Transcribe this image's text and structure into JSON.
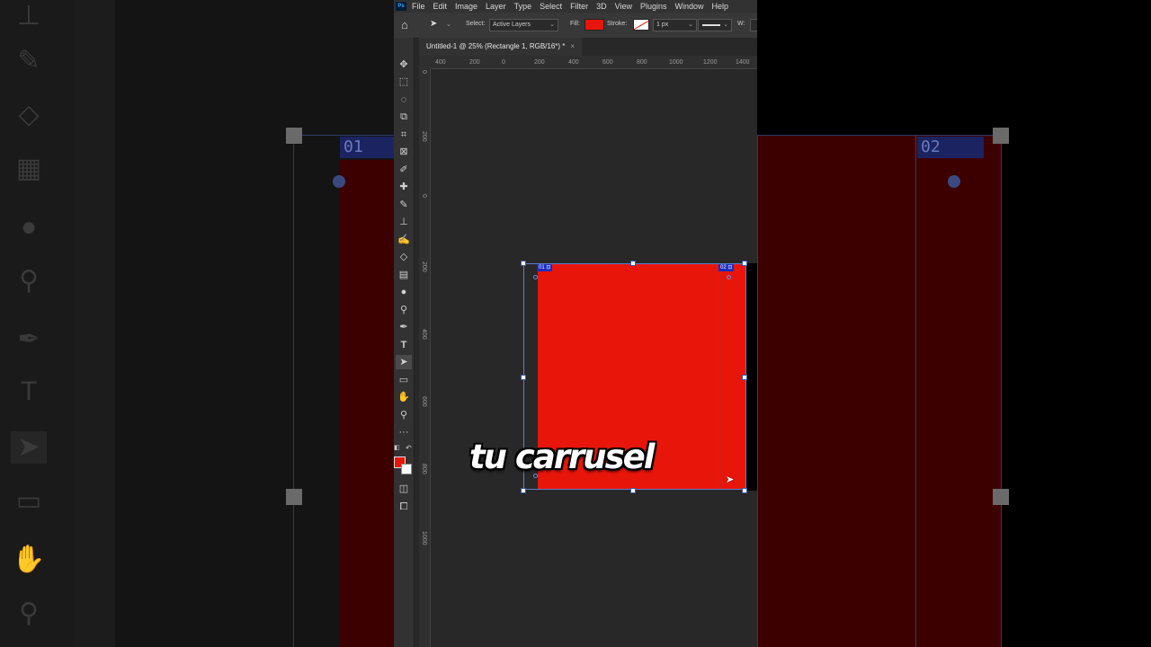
{
  "menu": [
    "File",
    "Edit",
    "Image",
    "Layer",
    "Type",
    "Select",
    "Filter",
    "3D",
    "View",
    "Plugins",
    "Window",
    "Help"
  ],
  "app_logo": "Ps",
  "options": {
    "select_label": "Select:",
    "select_value": "Active Layers",
    "fill_label": "Fill:",
    "stroke_label": "Stroke:",
    "stroke_size": "1 px",
    "w_label": "W:",
    "fill_color": "#e8150a"
  },
  "doc_tab": {
    "title": "Untitled-1 @ 25% (Rectangle 1, RGB/16*) *",
    "close": "×"
  },
  "ruler_top": [
    "400",
    "200",
    "0",
    "200",
    "400",
    "600",
    "800",
    "1000",
    "1200",
    "1400"
  ],
  "ruler_left": [
    "0",
    "200",
    "0",
    "200",
    "400",
    "600",
    "800",
    "1000"
  ],
  "artboard_badges": [
    "01",
    "02"
  ],
  "caption": "tu carrusel",
  "colors": {
    "accent_red": "#e8150a",
    "selection_blue": "#5a7fd0",
    "badge_blue": "#1a2cc0"
  },
  "tools": [
    "move-icon",
    "marquee-icon",
    "lasso-icon",
    "object-select-icon",
    "crop-icon",
    "frame-icon",
    "eyedropper-icon",
    "healing-brush-icon",
    "brush-icon",
    "clone-stamp-icon",
    "history-brush-icon",
    "eraser-icon",
    "gradient-icon",
    "blur-icon",
    "dodge-icon",
    "pen-icon",
    "type-icon",
    "path-select-icon",
    "rectangle-icon",
    "hand-icon",
    "zoom-icon",
    "more-tools-icon"
  ],
  "bg_ruler_marks": [
    "2",
    "0",
    "0",
    "0",
    "2",
    "0",
    "0",
    "4",
    "0",
    "0",
    "6",
    "0",
    "0",
    "8",
    "0",
    "0"
  ]
}
